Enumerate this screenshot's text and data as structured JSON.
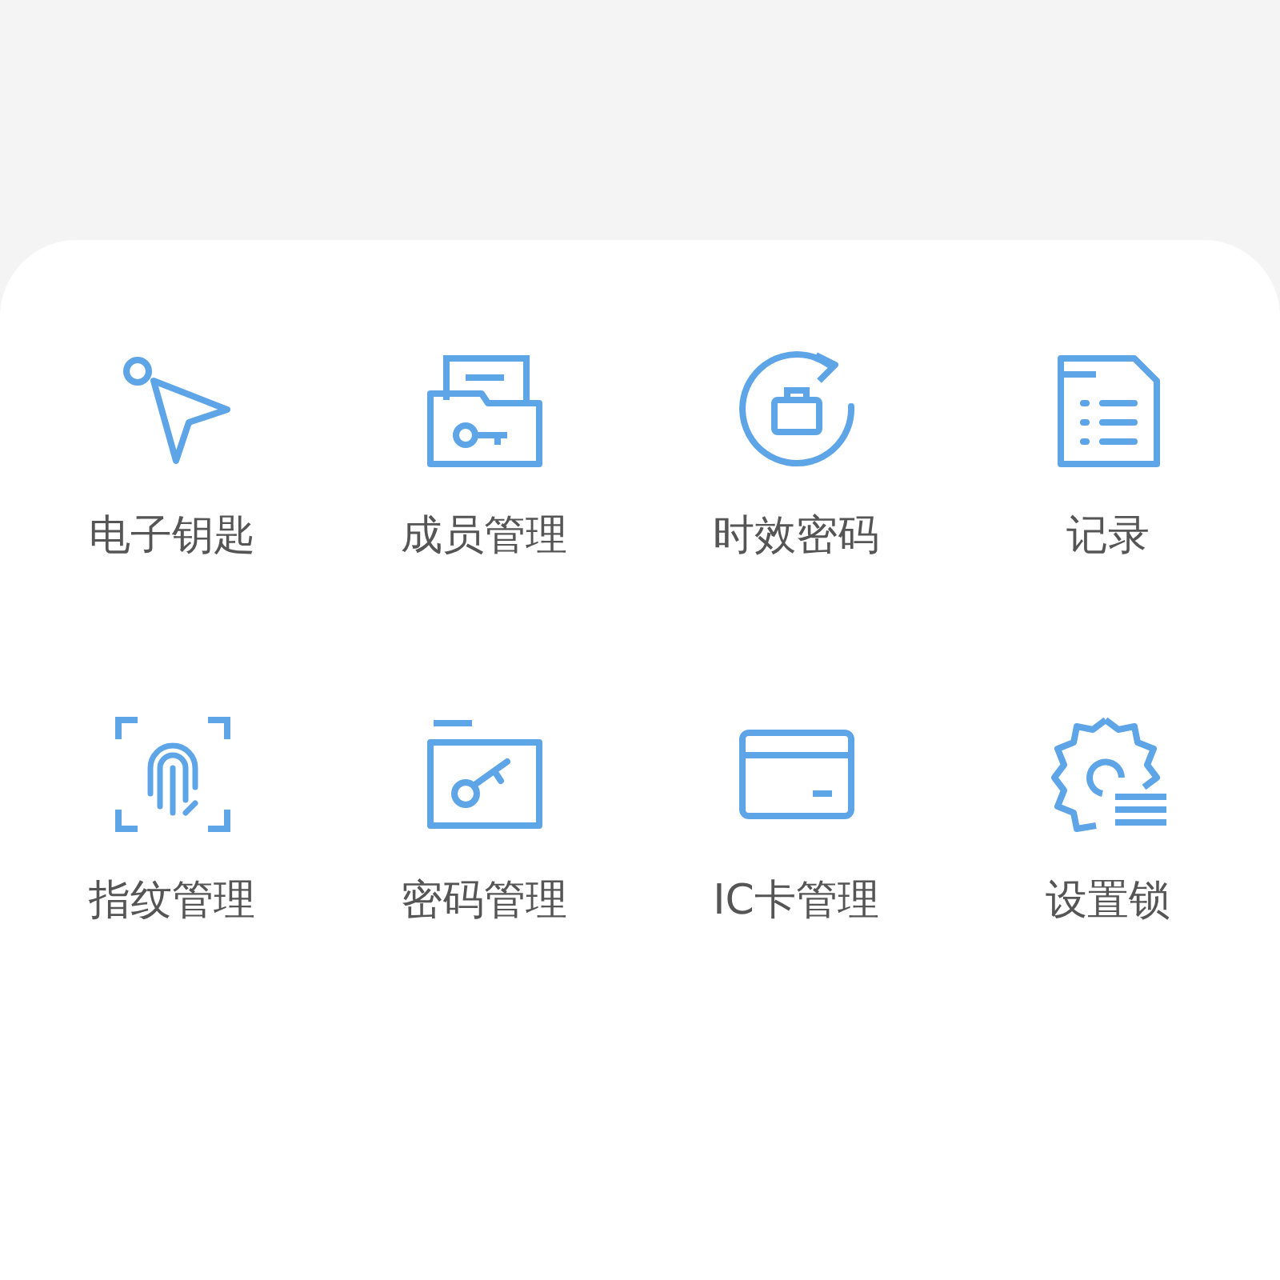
{
  "items": [
    {
      "label": "电子钥匙"
    },
    {
      "label": "成员管理"
    },
    {
      "label": "时效密码"
    },
    {
      "label": "记录"
    },
    {
      "label": "指纹管理"
    },
    {
      "label": "密码管理"
    },
    {
      "label": "IC卡管理"
    },
    {
      "label": "设置锁"
    }
  ]
}
